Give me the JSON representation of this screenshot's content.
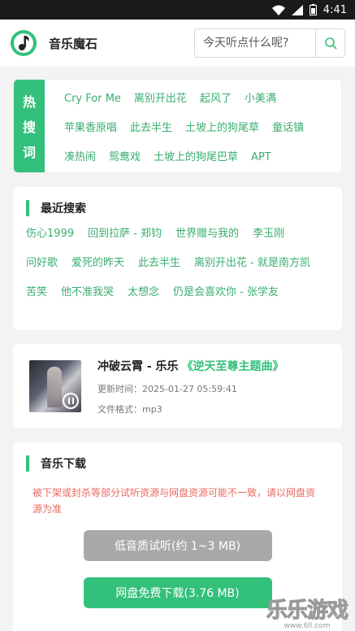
{
  "status": {
    "time": "4:41"
  },
  "header": {
    "title": "音乐魔石",
    "search_placeholder": "今天听点什么呢?"
  },
  "hot": {
    "label_chars": [
      "热",
      "搜",
      "词"
    ],
    "tags": [
      "Cry For Me",
      "离别开出花",
      "起风了",
      "小美满",
      "苹果香原唱",
      "此去半生",
      "土坡上的狗尾草",
      "童话镇",
      "凑热闹",
      "鸳鸯戏",
      "土坡上的狗尾巴草",
      "APT"
    ]
  },
  "recent": {
    "title": "最近搜索",
    "items": [
      "伤心1999",
      "回到拉萨 - 郑钧",
      "世界赠与我的",
      "李玉刚",
      "问好歌",
      "爱死的昨天",
      "此去半生",
      "离别开出花 - 就是南方凯",
      "苦笑",
      "他不准我哭",
      "太想念",
      "仍是会喜欢你 - 张学友"
    ]
  },
  "song": {
    "title": "冲破云霄 - 乐乐",
    "album": "《逆天至尊主题曲》",
    "updated": "更新时间：2025-01-27 05:59:41",
    "format": "文件格式：mp3"
  },
  "download": {
    "title": "音乐下载",
    "warning": "被下架或封杀等部分试听资源与网盘资源可能不一致，请以网盘资源为准",
    "low_quality_label": "低音质试听(约 1~3 MB)",
    "netdisk_label": "网盘免费下载(3.76 MB)"
  },
  "watermark": {
    "main": "乐乐游戏",
    "sub": "www.6ll.com"
  },
  "colors": {
    "accent": "#33c07b",
    "link": "#3aae70",
    "warning": "#e86a5f",
    "disabled": "#a9a9a9"
  }
}
